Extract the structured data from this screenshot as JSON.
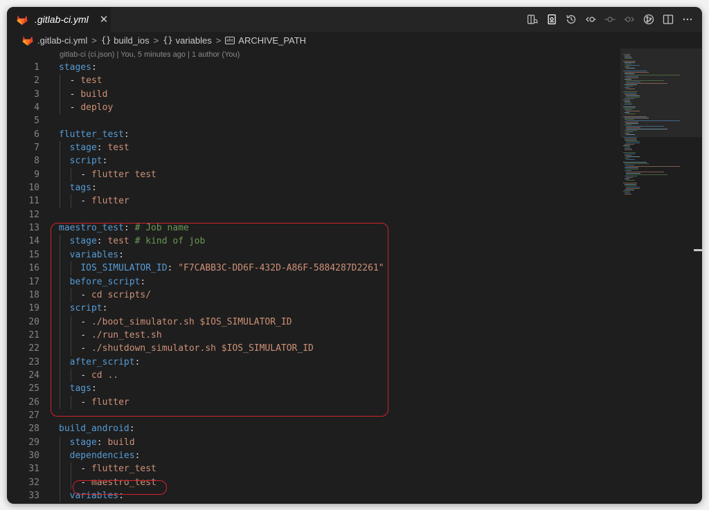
{
  "tab": {
    "title": ".gitlab-ci.yml",
    "close": "✕"
  },
  "breadcrumb": {
    "file": ".gitlab-ci.yml",
    "items": [
      "build_ios",
      "variables",
      "ARCHIVE_PATH"
    ],
    "obj_icon": "{}",
    "string_icon": "abc"
  },
  "blame": "gitlab-ci (ci.json) | You, 5 minutes ago | 1 author (You)",
  "colors": {
    "key": "#569cd6",
    "string": "#ce9178",
    "comment": "#6a9955",
    "highlight": "#d2232a"
  },
  "toolbar": [
    "open-changes-icon",
    "preview-icon",
    "history-icon",
    "compare-previous-icon",
    "compare-dot-icon",
    "compare-next-icon",
    "git-graph-icon",
    "split-editor-icon",
    "more-actions-icon"
  ],
  "code": [
    {
      "n": "1",
      "text": "stages:"
    },
    {
      "n": "2",
      "text": "  - test"
    },
    {
      "n": "3",
      "text": "  - build"
    },
    {
      "n": "4",
      "text": "  - deploy"
    },
    {
      "n": "5",
      "text": ""
    },
    {
      "n": "6",
      "text": "flutter_test:"
    },
    {
      "n": "7",
      "text": "  stage: test"
    },
    {
      "n": "8",
      "text": "  script:"
    },
    {
      "n": "9",
      "text": "    - flutter test"
    },
    {
      "n": "10",
      "text": "  tags:"
    },
    {
      "n": "11",
      "text": "    - flutter"
    },
    {
      "n": "12",
      "text": ""
    },
    {
      "n": "13",
      "text": "maestro_test: # Job name"
    },
    {
      "n": "14",
      "text": "  stage: test # kind of job"
    },
    {
      "n": "15",
      "text": "  variables:"
    },
    {
      "n": "16",
      "text": "    IOS_SIMULATOR_ID: \"F7CABB3C-DD6F-432D-A86F-5884287D2261\""
    },
    {
      "n": "17",
      "text": "  before_script:"
    },
    {
      "n": "18",
      "text": "    - cd scripts/"
    },
    {
      "n": "19",
      "text": "  script:"
    },
    {
      "n": "20",
      "text": "    - ./boot_simulator.sh $IOS_SIMULATOR_ID"
    },
    {
      "n": "21",
      "text": "    - ./run_test.sh"
    },
    {
      "n": "22",
      "text": "    - ./shutdown_simulator.sh $IOS_SIMULATOR_ID"
    },
    {
      "n": "23",
      "text": "  after_script:"
    },
    {
      "n": "24",
      "text": "    - cd .."
    },
    {
      "n": "25",
      "text": "  tags:"
    },
    {
      "n": "26",
      "text": "    - flutter"
    },
    {
      "n": "27",
      "text": ""
    },
    {
      "n": "28",
      "text": "build_android:"
    },
    {
      "n": "29",
      "text": "  stage: build"
    },
    {
      "n": "30",
      "text": "  dependencies:"
    },
    {
      "n": "31",
      "text": "    - flutter_test"
    },
    {
      "n": "32",
      "text": "    - maestro_test"
    },
    {
      "n": "33",
      "text": "  variables:"
    }
  ]
}
